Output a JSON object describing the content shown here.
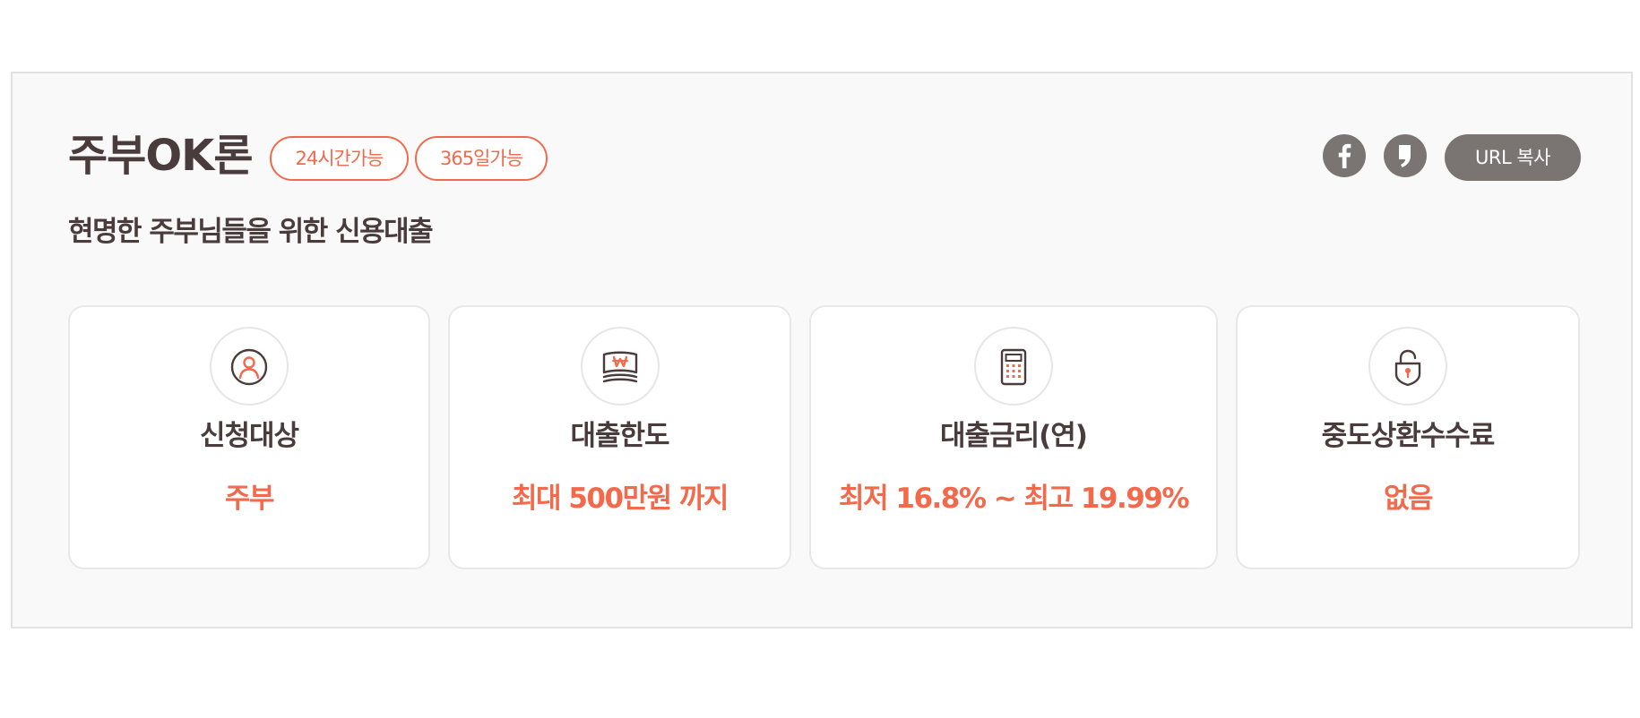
{
  "product": {
    "title": "주부OK론",
    "badges": [
      "24시간가능",
      "365일가능"
    ],
    "subtitle": "현명한 주부님들을 위한 신용대출"
  },
  "share": {
    "facebook_icon": "facebook-icon",
    "kakaostory_icon": "kakaostory-icon",
    "url_copy_label": "URL 복사"
  },
  "cards": [
    {
      "icon": "person-icon",
      "label": "신청대상",
      "value": "주부"
    },
    {
      "icon": "money-icon",
      "label": "대출한도",
      "value": "최대 500만원 까지"
    },
    {
      "icon": "calculator-icon",
      "label": "대출금리(연)",
      "value": "최저 16.8% ~ 최고 19.99%"
    },
    {
      "icon": "lock-icon",
      "label": "중도상환수수료",
      "value": "없음"
    }
  ],
  "colors": {
    "accent": "#f26a4b",
    "title_text": "#4a3c3c",
    "share_gray": "#7a7473",
    "panel_bg": "#f9f9f9"
  }
}
